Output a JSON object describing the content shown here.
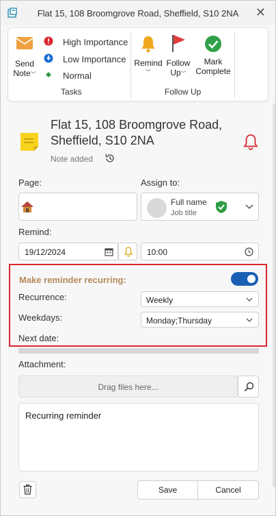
{
  "window": {
    "title": "Flat 15, 108 Broomgrove Road, Sheffield, S10 2NA"
  },
  "ribbon": {
    "send_note_label_1": "Send",
    "send_note_label_2": "Note",
    "importance": {
      "high": "High Importance",
      "low": "Low Importance",
      "normal": "Normal"
    },
    "tasks_group": "Tasks",
    "remind_label": "Remind",
    "follow_up_label_1": "Follow",
    "follow_up_label_2": "Up",
    "mark_complete_label_1": "Mark",
    "mark_complete_label_2": "Complete",
    "follow_up_group": "Follow Up",
    "colors": {
      "high": "#d9272e",
      "low": "#1a6fd4",
      "normal": "#2f9e44",
      "flag": "#e23b3b",
      "check": "#2fa14a",
      "bell": "#f0a81e"
    }
  },
  "note": {
    "title_line1": "Flat 15, 108 Broomgrove Road,",
    "title_line2": "Sheffield, S10 2NA",
    "status": "Note added"
  },
  "form": {
    "page_label": "Page:",
    "assign_label": "Assign to:",
    "assignee_name": "Full name",
    "assignee_role": "Job title",
    "remind_label": "Remind:",
    "remind_date": "19/12/2024",
    "remind_time": "10:00"
  },
  "recurrence": {
    "title": "Make reminder recurring:",
    "enabled": true,
    "recurrence_label": "Recurrence:",
    "recurrence_value": "Weekly",
    "weekdays_label": "Weekdays:",
    "weekdays_value": "Monday;Thursday",
    "next_date_label": "Next date:"
  },
  "attachment": {
    "label": "Attachment:",
    "drop_placeholder": "Drag files here..."
  },
  "notes_text": "Recurring reminder",
  "footer": {
    "save": "Save",
    "cancel": "Cancel"
  }
}
